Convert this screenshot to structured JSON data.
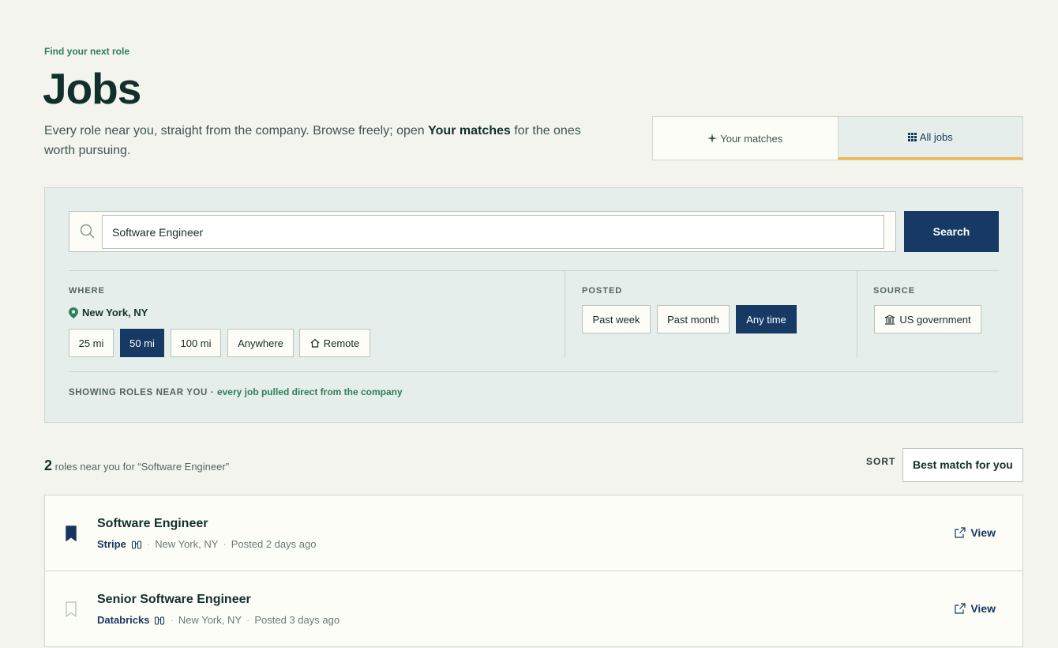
{
  "header": {
    "eyebrow": "Find your next role",
    "title": "Jobs",
    "intro_before": "Every role near you, straight from the company. Browse freely; open ",
    "intro_strong": "Your matches",
    "intro_after": " for the ones worth pursuing."
  },
  "tabs": [
    {
      "label": "Your matches",
      "icon": "sparkle-icon",
      "active": false
    },
    {
      "label": "All jobs",
      "icon": "grid-icon",
      "active": true
    }
  ],
  "search": {
    "value": "Software Engineer",
    "button_label": "Search"
  },
  "filters": {
    "where_label": "WHERE",
    "location": "New York, NY",
    "distance_chips": [
      "25 mi",
      "50 mi",
      "100 mi",
      "Anywhere",
      "Remote"
    ],
    "distance_selected": "50 mi",
    "posted_label": "POSTED",
    "posted_chips": [
      "Past week",
      "Past month",
      "Any time"
    ],
    "posted_selected": "Any time",
    "source_label": "SOURCE",
    "source_chip": "US government"
  },
  "showing": {
    "prefix": "SHOWING ROLES NEAR YOU ·",
    "note": "every job pulled direct from the company"
  },
  "results": {
    "count": "2",
    "summary": "roles near you for “Software Engineer”",
    "sort_label": "SORT",
    "sort_value": "Best match for you"
  },
  "jobs": [
    {
      "title": "Software Engineer",
      "company": "Stripe",
      "location": "New York, NY",
      "posted": "Posted 2 days ago",
      "saved": true,
      "action": "View"
    },
    {
      "title": "Senior Software Engineer",
      "company": "Databricks",
      "location": "New York, NY",
      "posted": "Posted 3 days ago",
      "saved": false,
      "action": "View"
    }
  ],
  "colors": {
    "accent": "#163a64",
    "green": "#2e7d5b",
    "tab_underline": "#f0b24a",
    "background": "#f4f4ef"
  }
}
